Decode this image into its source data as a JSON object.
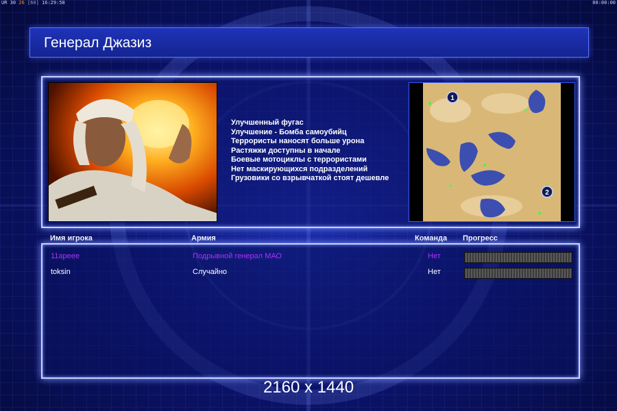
{
  "status_bar": {
    "left_prefix": "UR 30",
    "fps": "26",
    "fps_secondary": "[60]",
    "clock": "16:29:58",
    "right_timer": "00:00:00"
  },
  "title": "Генерал Джазиз",
  "general_features": [
    "Улучшенный фугас",
    "Улучшение - Бомба самоубийц",
    "Террористы наносят больше урона",
    "Растяжки доступны в начале",
    "Боевые мотоциклы с террористами",
    "Нет маскирующихся подразделений",
    "Грузовики со взрывчаткой стоят дешевле"
  ],
  "minimap": {
    "start_positions": [
      "1",
      "2"
    ]
  },
  "players_table": {
    "headers": {
      "name": "Имя игрока",
      "army": "Армия",
      "team": "Команда",
      "progress": "Прогресс"
    },
    "rows": [
      {
        "name": "11apeee",
        "army": "Подрывной генерал МАО",
        "team": "Нет",
        "color": "#b030ff"
      },
      {
        "name": "toksin",
        "army": "Случайно",
        "team": "Нет",
        "color": "#ffffff"
      }
    ]
  },
  "resolution_label": "2160 x 1440",
  "colors": {
    "panel_border": "#c8d2ff",
    "title_bar": "#1e33b8",
    "player1": "#b030ff",
    "player2": "#ffffff"
  }
}
